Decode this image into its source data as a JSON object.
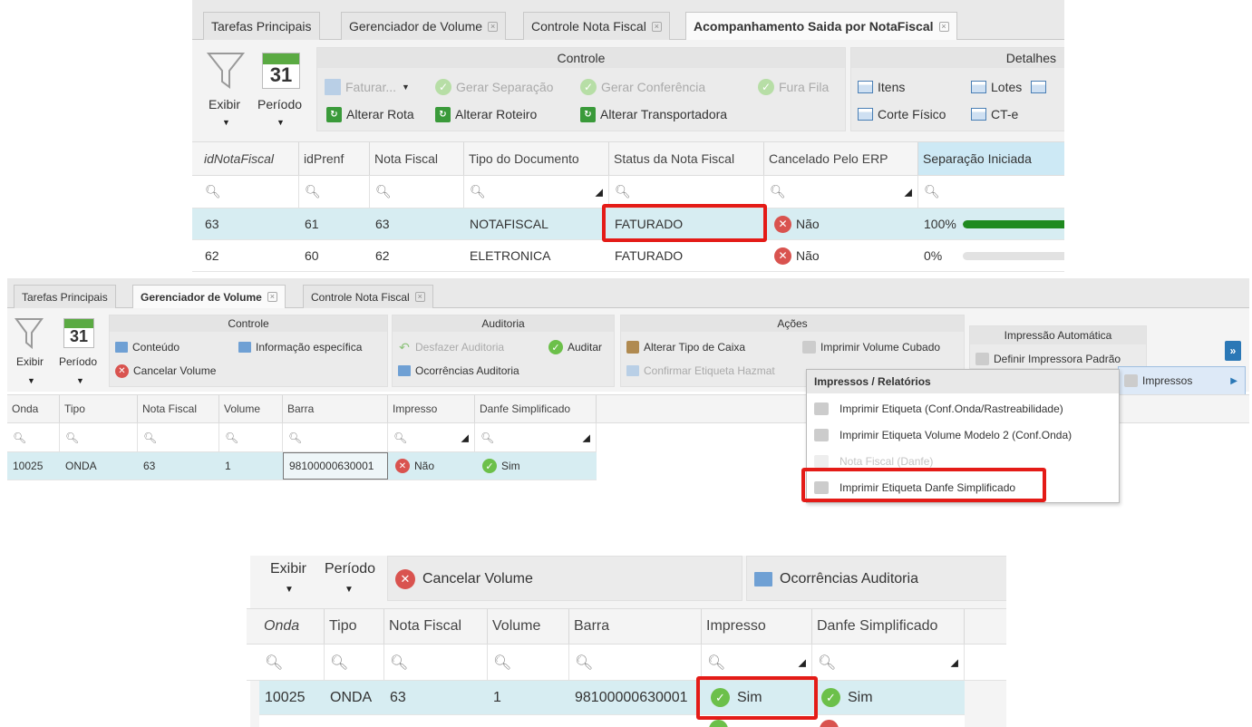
{
  "top": {
    "tabs": [
      {
        "label": "Tarefas Principais"
      },
      {
        "label": "Gerenciador de Volume",
        "close": "×"
      },
      {
        "label": "Controle Nota Fiscal",
        "close": "×"
      },
      {
        "label": "Acompanhamento Saida por NotaFiscal",
        "close": "×"
      }
    ],
    "exibir": "Exibir",
    "periodo": "Período",
    "calendar_day": "31",
    "controle_title": "Controle",
    "faturar": "Faturar...",
    "gerar_separacao": "Gerar Separação",
    "gerar_conferencia": "Gerar Conferência",
    "fura_fila": "Fura Fila",
    "alterar_rota": "Alterar Rota",
    "alterar_roteiro": "Alterar Roteiro",
    "alterar_transportadora": "Alterar Transportadora",
    "detalhes_title": "Detalhes",
    "itens": "Itens",
    "lotes": "Lotes",
    "corte_fisico": "Corte Físico",
    "cte": "CT-e",
    "columns": [
      "idNotaFiscal",
      "idPrenf",
      "Nota Fiscal",
      "Tipo do Documento",
      "Status da Nota Fiscal",
      "Cancelado Pelo ERP",
      "Separação Iniciada"
    ],
    "rows": [
      {
        "idNotaFiscal": "63",
        "idPrenf": "61",
        "notaFiscal": "63",
        "tipo": "NOTAFISCAL",
        "status": "FATURADO",
        "cancelado": "Não",
        "separacao": "100%",
        "progress": 1.0
      },
      {
        "idNotaFiscal": "62",
        "idPrenf": "60",
        "notaFiscal": "62",
        "tipo": "ELETRONICA",
        "status": "FATURADO",
        "cancelado": "Não",
        "separacao": "0%",
        "progress": 0.0
      }
    ]
  },
  "middle": {
    "tabs": [
      {
        "label": "Tarefas Principais"
      },
      {
        "label": "Gerenciador de Volume",
        "close": "×"
      },
      {
        "label": "Controle Nota Fiscal",
        "close": "×"
      }
    ],
    "exibir": "Exibir",
    "periodo": "Período",
    "calendar_day": "31",
    "controle_title": "Controle",
    "conteudo": "Conteúdo",
    "informacao_especifica": "Informação específica",
    "cancelar_volume": "Cancelar Volume",
    "auditoria_title": "Auditoria",
    "desfazer_auditoria": "Desfazer Auditoria",
    "auditar": "Auditar",
    "ocorrencias_auditoria": "Ocorrências Auditoria",
    "acoes_title": "Ações",
    "alterar_tipo_caixa": "Alterar Tipo de Caixa",
    "imprimir_volume_cubado": "Imprimir Volume Cubado",
    "confirmar_etiqueta_hazmat": "Confirmar Etiqueta Hazmat",
    "impressao_automatica_title": "Impressão Automática",
    "definir_impressora_padrao": "Definir Impressora Padrão",
    "more": "»",
    "impressos": "Impressos",
    "menu": {
      "header": "Impressos / Relatórios",
      "items": [
        {
          "label": "Imprimir Etiqueta (Conf.Onda/Rastreabilidade)",
          "disabled": false
        },
        {
          "label": "Imprimir Etiqueta Volume Modelo 2 (Conf.Onda)",
          "disabled": false
        },
        {
          "label": "Nota Fiscal (Danfe)",
          "disabled": true
        },
        {
          "label": "Imprimir Etiqueta Danfe Simplificado",
          "disabled": false
        }
      ]
    },
    "columns": [
      "Onda",
      "Tipo",
      "Nota Fiscal",
      "Volume",
      "Barra",
      "Impresso",
      "Danfe Simplificado"
    ],
    "row": {
      "onda": "10025",
      "tipo": "ONDA",
      "notaFiscal": "63",
      "volume": "1",
      "barra": "98100000630001",
      "impresso": "Não",
      "danfe": "Sim"
    }
  },
  "bottom": {
    "exibir": "Exibir",
    "periodo": "Período",
    "cancelar_volume": "Cancelar Volume",
    "ocorrencias_auditoria": "Ocorrências Auditoria",
    "columns": [
      "Onda",
      "Tipo",
      "Nota Fiscal",
      "Volume",
      "Barra",
      "Impresso",
      "Danfe Simplificado"
    ],
    "row": {
      "onda": "10025",
      "tipo": "ONDA",
      "notaFiscal": "63",
      "volume": "1",
      "barra": "98100000630001",
      "impresso": "Sim",
      "danfe": "Sim"
    }
  },
  "colors": {
    "highlight": "#e41b17",
    "selected_row": "#d7edf2",
    "progress": "#1f8a1f",
    "ok": "#6cc04a",
    "error": "#d9534f"
  }
}
